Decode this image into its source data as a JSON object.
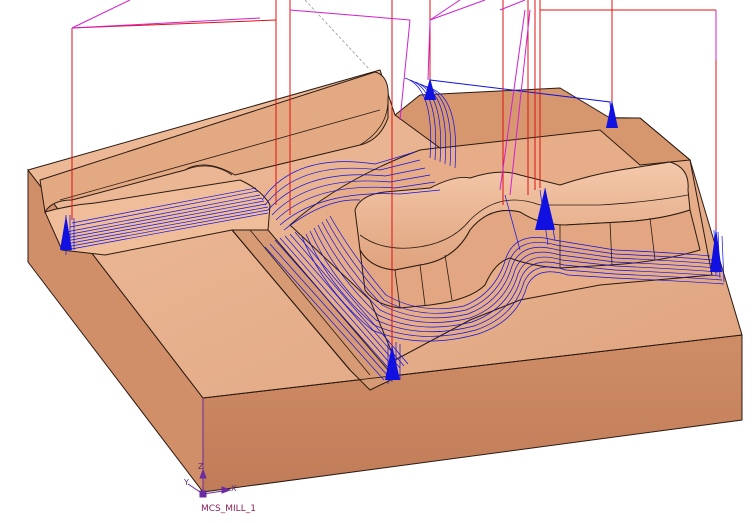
{
  "viewport": {
    "background": "#ffffff"
  },
  "colors": {
    "part_top": "#e7b08d",
    "part_front": "#c98762",
    "part_side": "#d89a76",
    "part_edge": "#2b1a12",
    "toolpath_cut": "#1010e0",
    "toolpath_rapid": "#e01010",
    "toolpath_engage": "#d020d0",
    "mcs": "#6a2aa0"
  },
  "coordinate_system": {
    "label": "MCS_MILL_1",
    "icon": "mcs-triad-icon",
    "axes": [
      "X",
      "Y",
      "Z"
    ]
  }
}
